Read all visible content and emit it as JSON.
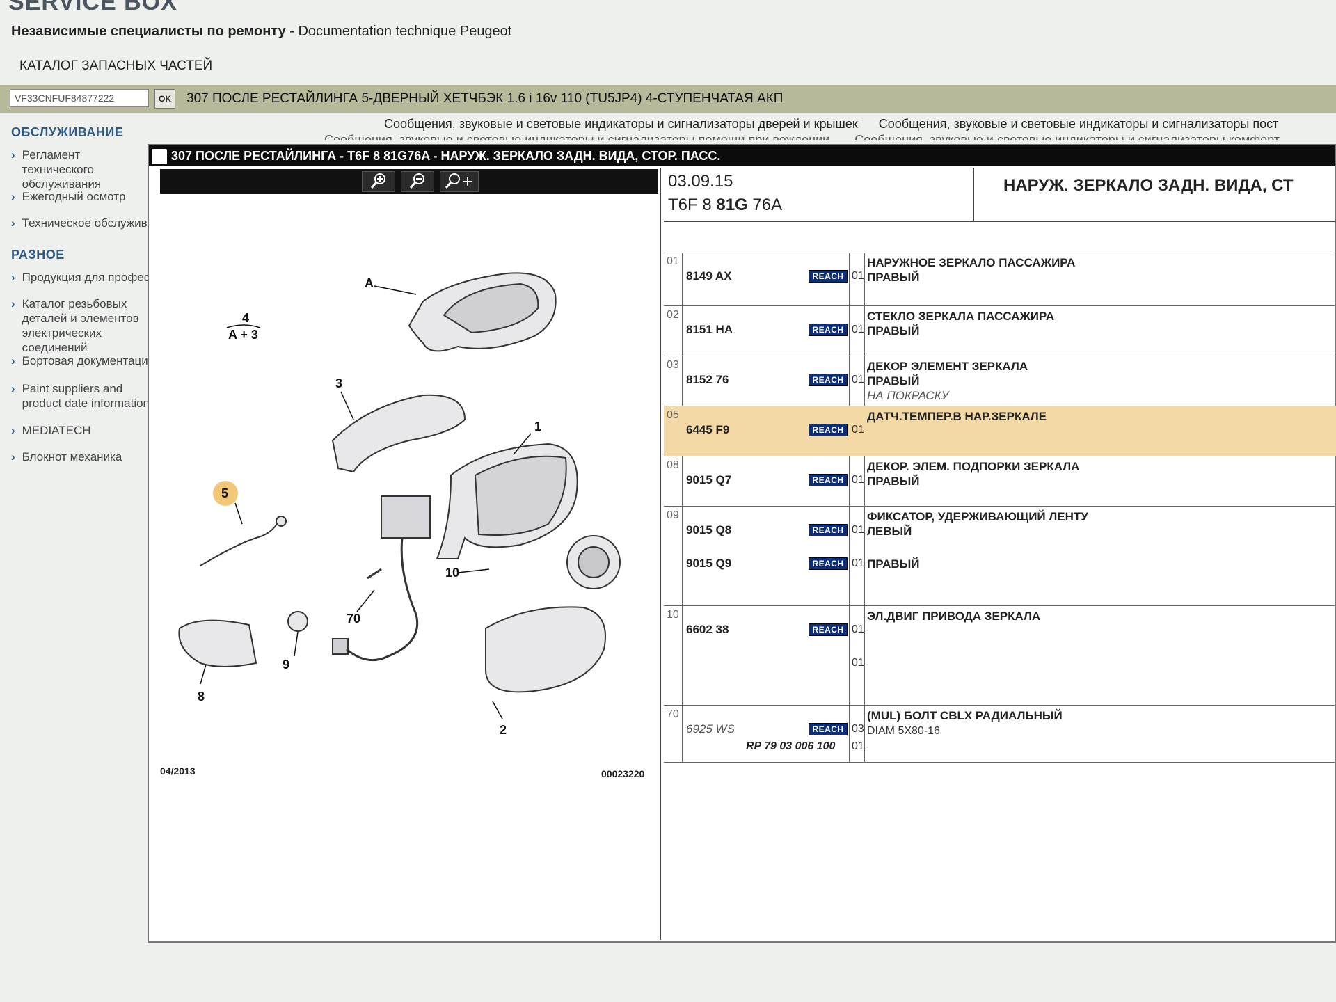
{
  "app": {
    "brand": "SERVICE BOX",
    "subtitle_bold": "Независимые специалисты по ремонту",
    "subtitle_rest": " - Documentation technique Peugeot",
    "catalog_title": "КАТАЛОГ ЗАПАСНЫХ ЧАСТЕЙ"
  },
  "vin_bar": {
    "vin": "VF33CNFUF84877222",
    "ok_label": "OK",
    "vehicle": "307 ПОСЛЕ РЕСТАЙЛИНГА 5-ДВЕРНЫЙ ХЕТЧБЭК 1.6 i 16v 110 (TU5JP4) 4-СТУПЕНЧАТАЯ АКП"
  },
  "background_messages": [
    "Сообщения, звуковые и световые индикаторы и сигнализаторы дверей и крышек",
    "Сообщения, звуковые и световые индикаторы и сигнализаторы пост"
  ],
  "background_messages_2": [
    "Сообщения, звуковые и световые индикаторы и сигнализаторы помощи при вождении",
    "Сообщения, звуковые и световые индикаторы и сигнализаторы комфорт"
  ],
  "sidebar": {
    "section1": "ОБСЛУЖИВАНИЕ",
    "items1": [
      "Регламент технического обслуживания",
      "Ежегодный осмотр",
      "Техническое обслуживание"
    ],
    "section2": "РАЗНОЕ",
    "items2": [
      "Продукция для профессионалов",
      "Каталог резьбовых деталей и элементов электрических соединений",
      "Бортовая документация",
      "Paint suppliers and product date information",
      "MEDIATECH",
      "Блокнот механика"
    ]
  },
  "window": {
    "title": "307 ПОСЛЕ РЕСТАЙЛИНГА - T6F 8 81G76A - НАРУЖ. ЗЕРКАЛО ЗАДН. ВИДА, СТОР. ПАСС.",
    "tools": [
      "zoom-in",
      "zoom-out",
      "zoom-pan"
    ]
  },
  "diagram": {
    "labels": {
      "a": "A",
      "n4": "4",
      "a3": "A + 3",
      "n3": "3",
      "n1": "1",
      "n5": "5",
      "n10": "10",
      "n70": "70",
      "n9": "9",
      "n8": "8",
      "n2": "2"
    },
    "date": "04/2013",
    "number": "00023220"
  },
  "parts_header": {
    "date": "03.09.15",
    "code_prefix": "T6F 8 ",
    "code_bold": "81G",
    "code_suffix": " 76A",
    "title": "НАРУЖ. ЗЕРКАЛО ЗАДН. ВИДА, СТ"
  },
  "parts": [
    {
      "pos": "01",
      "ref": "8149 AX",
      "reach": "REACH",
      "qty": "01",
      "desc": "НАРУЖНОЕ ЗЕРКАЛО ПАССАЖИРА",
      "desc2": "ПРАВЫЙ"
    },
    {
      "pos": "02",
      "ref": "8151 HA",
      "reach": "REACH",
      "qty": "01",
      "desc": "СТЕКЛО ЗЕРКАЛА ПАССАЖИРА",
      "desc2": "ПРАВЫЙ"
    },
    {
      "pos": "03",
      "ref": "8152 76",
      "reach": "REACH",
      "qty": "01",
      "desc": "ДЕКОР ЭЛЕМЕНТ ЗЕРКАЛА",
      "desc2": "ПРАВЫЙ",
      "note": "НА ПОКРАСКУ"
    },
    {
      "pos": "05",
      "ref": "6445 F9",
      "reach": "REACH",
      "qty": "01",
      "desc": "ДАТЧ.ТЕМПЕР.В НАР.ЗЕРКАЛЕ"
    },
    {
      "pos": "08",
      "ref": "9015 Q7",
      "reach": "REACH",
      "qty": "01",
      "desc": "ДЕКОР. ЭЛЕМ. ПОДПОРКИ ЗЕРКАЛА",
      "desc2": "ПРАВЫЙ"
    },
    {
      "pos": "09",
      "ref": "9015 Q8",
      "reach": "REACH",
      "qty": "01",
      "desc": "ФИКСАТОР, УДЕРЖИВАЮЩИЙ ЛЕНТУ",
      "desc2": "ЛЕВЫЙ",
      "ref_b": "9015 Q9",
      "qty_b": "01",
      "desc_b": "ПРАВЫЙ"
    },
    {
      "pos": "10",
      "ref": "6602 38",
      "reach": "REACH",
      "qty": "01",
      "qty_b": "01",
      "desc": "ЭЛ.ДВИГ ПРИВОДА ЗЕРКАЛА"
    },
    {
      "pos": "70",
      "ref": "6925 WS",
      "reach": "REACH",
      "qty": "03",
      "qty_b": "01",
      "desc": "(MUL) БОЛТ CBLX РАДИАЛЬНЫЙ",
      "desc2": "DIAM 5X80-16",
      "supersede": "RP 79 03 006 100"
    }
  ],
  "colors": {
    "highlight_row": "#f3d9a6",
    "reach_badge": "#0b2f7a",
    "sidebar_heading": "#2d5a86",
    "vin_bar": "#b8b89a"
  }
}
